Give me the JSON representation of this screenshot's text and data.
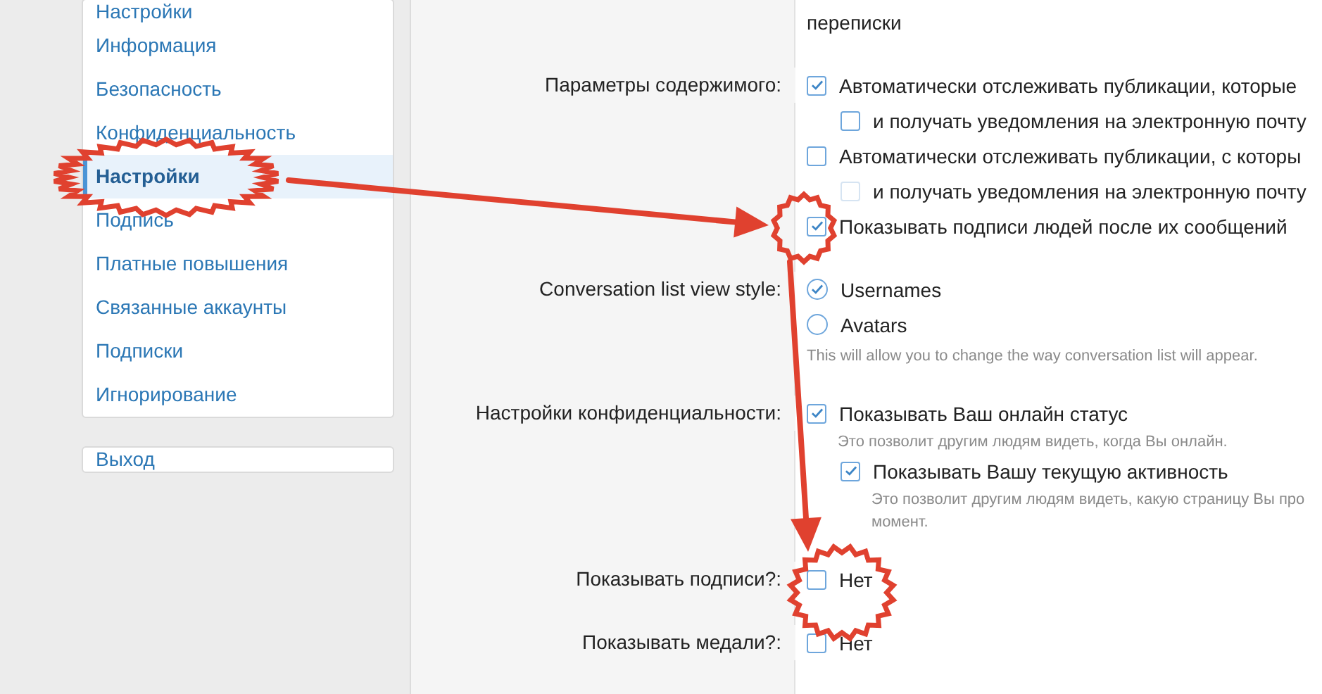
{
  "sidebar": {
    "items": [
      {
        "label": "Настройки",
        "selected": false
      },
      {
        "label": "Информация",
        "selected": false
      },
      {
        "label": "Безопасность",
        "selected": false
      },
      {
        "label": "Конфиденциальность",
        "selected": false
      },
      {
        "label": "Настройки",
        "selected": true
      },
      {
        "label": "Подпись",
        "selected": false
      },
      {
        "label": "Платные повышения",
        "selected": false
      },
      {
        "label": "Связанные аккаунты",
        "selected": false
      },
      {
        "label": "Подписки",
        "selected": false
      },
      {
        "label": "Игнорирование",
        "selected": false
      }
    ],
    "logout": {
      "label": "Выход"
    }
  },
  "settings": {
    "rows": [
      {
        "options": [
          {
            "kind": "text",
            "text": "переписки"
          }
        ]
      },
      {
        "label": "Параметры содержимого:",
        "options": [
          {
            "kind": "checkbox",
            "text": "Автоматически отслеживать публикации, которые",
            "checked": true,
            "disabled": false,
            "children": [
              {
                "kind": "checkbox",
                "text": "и получать уведомления на электронную почту",
                "checked": false,
                "disabled": false
              }
            ]
          },
          {
            "kind": "checkbox",
            "text": "Автоматически отслеживать публикации, с которы",
            "checked": false,
            "disabled": false,
            "children": [
              {
                "kind": "checkbox",
                "text": "и получать уведомления на электронную почту",
                "checked": false,
                "disabled": true
              }
            ]
          },
          {
            "kind": "checkbox",
            "text": "Показывать подписи людей после их сообщений",
            "checked": true,
            "disabled": false
          }
        ]
      },
      {
        "label": "Conversation list view style:",
        "options": [
          {
            "kind": "radio",
            "text": "Usernames",
            "selected": true
          },
          {
            "kind": "radio",
            "text": "Avatars",
            "selected": false
          }
        ],
        "hint": [
          "This will allow you to change the way conversation list will appear."
        ]
      },
      {
        "label": "Настройки конфиденциальности:",
        "options": [
          {
            "kind": "checkbox",
            "text": "Показывать Ваш онлайн статус",
            "checked": true,
            "disabled": false,
            "hint": [
              "Это позволит другим людям видеть, когда Вы онлайн."
            ],
            "children": [
              {
                "kind": "checkbox",
                "text": "Показывать Вашу текущую активность",
                "checked": true,
                "disabled": false,
                "hint": [
                  "Это позволит другим людям видеть, какую страницу Вы про",
                  "момент."
                ]
              }
            ]
          }
        ]
      },
      {
        "label": "Показывать подписи?:",
        "options": [
          {
            "kind": "checkbox",
            "text": "Нет",
            "checked": false,
            "disabled": false
          }
        ]
      },
      {
        "label": "Показывать медали?:",
        "options": [
          {
            "kind": "checkbox",
            "text": "Нет",
            "checked": false,
            "disabled": false
          }
        ]
      }
    ]
  }
}
